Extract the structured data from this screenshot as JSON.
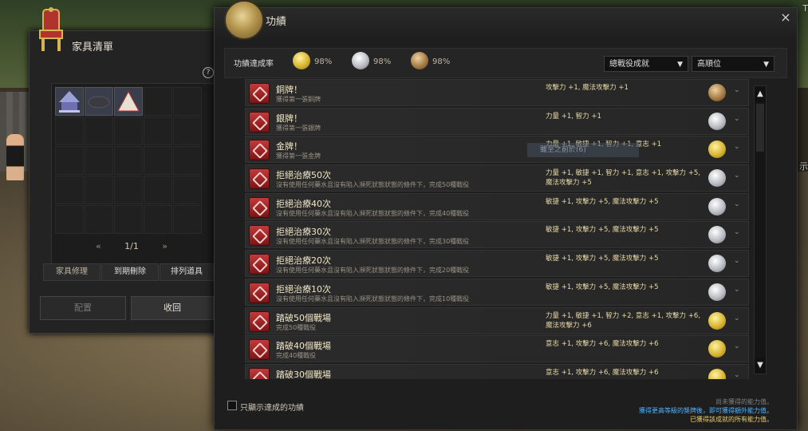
{
  "furniture": {
    "title": "家具清單",
    "help_icon": "?",
    "pager": {
      "prev": "«",
      "page": "1/1",
      "next": "»"
    },
    "buttons": {
      "repair": "家具修理",
      "expire_delete": "到期刪除",
      "sort": "排列道具"
    },
    "big_buttons": {
      "place": "配置",
      "retrieve": "收回"
    }
  },
  "achievements": {
    "title": "功績",
    "close_icon": "×",
    "rate_label": "功績達成率",
    "rates": [
      {
        "medal": "gold",
        "value": "98%"
      },
      {
        "medal": "silver",
        "value": "98%"
      },
      {
        "medal": "bronze",
        "value": "98%"
      }
    ],
    "filter_category": "總戰役成就",
    "filter_sort": "高順位",
    "ghost_text": "雖至之前於(6)",
    "rows": [
      {
        "name": "銅牌！",
        "desc": "獲得第一張銅牌",
        "reward": "攻擊力 +1, 魔法攻擊力 +1",
        "medal": "bronze"
      },
      {
        "name": "銀牌！",
        "desc": "獲得第一張銀牌",
        "reward": "力量 +1, 智力 +1",
        "medal": "silver"
      },
      {
        "name": "金牌！",
        "desc": "獲得第一張金牌",
        "reward": "力量 +1, 敏捷 +1, 智力 +1, 意志 +1",
        "medal": "gold"
      },
      {
        "name": "拒絕治療50次",
        "desc": "沒有使用任何藥水且沒有陷入瀕死狀態狀態的條件下，完成50種戰役",
        "reward": "力量 +1, 敏捷 +1, 智力 +1, 意志 +1, 攻擊力 +5, 魔法攻擊力 +5",
        "medal": "silver"
      },
      {
        "name": "拒絕治療40次",
        "desc": "沒有使用任何藥水且沒有陷入瀕死狀態狀態的條件下，完成40種戰役",
        "reward": "敏捷 +1, 攻擊力 +5, 魔法攻擊力 +5",
        "medal": "silver"
      },
      {
        "name": "拒絕治療30次",
        "desc": "沒有使用任何藥水且沒有陷入瀕死狀態狀態的條件下，完成30種戰役",
        "reward": "敏捷 +1, 攻擊力 +5, 魔法攻擊力 +5",
        "medal": "silver"
      },
      {
        "name": "拒絕治療20次",
        "desc": "沒有使用任何藥水且沒有陷入瀕死狀態狀態的條件下，完成20種戰役",
        "reward": "敏捷 +1, 攻擊力 +5, 魔法攻擊力 +5",
        "medal": "silver"
      },
      {
        "name": "拒絕治療10次",
        "desc": "沒有使用任何藥水且沒有陷入瀕死狀態狀態的條件下，完成10種戰役",
        "reward": "敏捷 +1, 攻擊力 +5, 魔法攻擊力 +5",
        "medal": "silver"
      },
      {
        "name": "踏破50個戰場",
        "desc": "完成50種戰役",
        "reward": "力量 +1, 敏捷 +1, 智力 +2, 意志 +1, 攻擊力 +6, 魔法攻擊力 +6",
        "medal": "gold"
      },
      {
        "name": "踏破40個戰場",
        "desc": "完成40種戰役",
        "reward": "意志 +1, 攻擊力 +6, 魔法攻擊力 +6",
        "medal": "gold"
      },
      {
        "name": "踏破30個戰場",
        "desc": "",
        "reward": "意志 +1, 攻擊力 +6, 魔法攻擊力 +6",
        "medal": "gold"
      }
    ],
    "show_completed_label": "只顯示達成的功績",
    "legend": {
      "line1": "尚未獲得的能力值。",
      "line2": "獲得更高等級的獎牌後，即可獲得額外能力值。",
      "line3": "已獲得該成就的所有能力值。"
    }
  },
  "hud": {
    "r1": "T",
    "r2": "示"
  },
  "colors": {
    "gold": "#d8b532",
    "silver": "#b9bcc2",
    "bronze": "#a57c46",
    "legend_blue": "#4fb2ff",
    "legend_gold": "#e8cc6a"
  }
}
